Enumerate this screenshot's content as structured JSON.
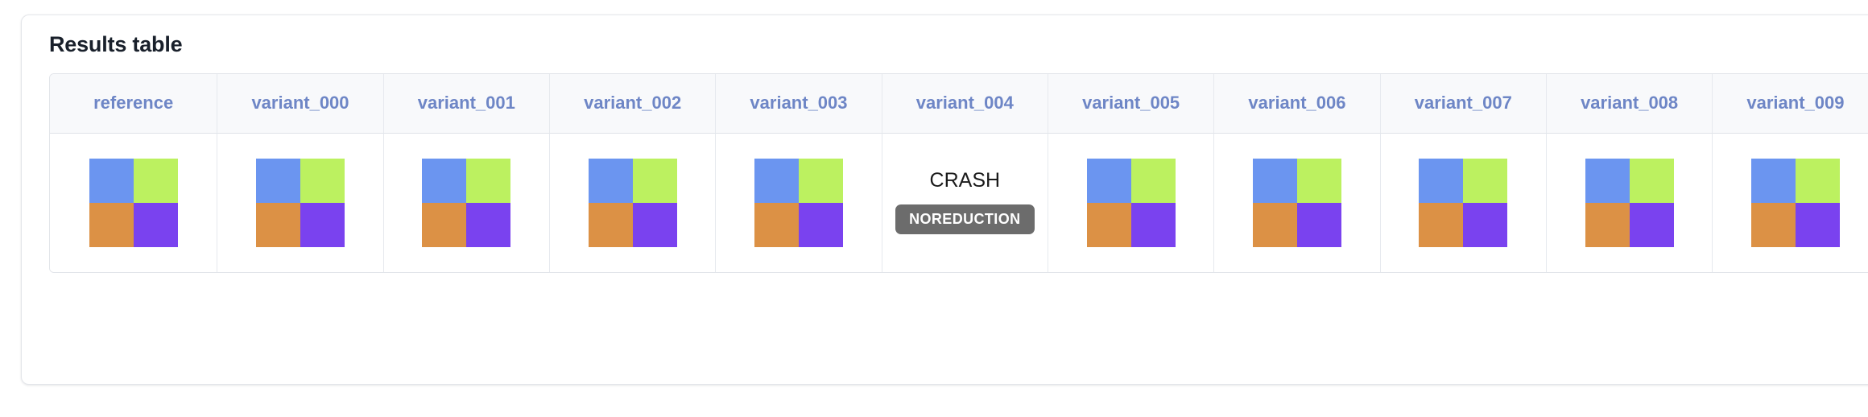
{
  "card": {
    "title": "Results table"
  },
  "table": {
    "columns": [
      {
        "label": "reference"
      },
      {
        "label": "variant_000"
      },
      {
        "label": "variant_001"
      },
      {
        "label": "variant_002"
      },
      {
        "label": "variant_003"
      },
      {
        "label": "variant_004"
      },
      {
        "label": "variant_005"
      },
      {
        "label": "variant_006"
      },
      {
        "label": "variant_007"
      },
      {
        "label": "variant_008"
      },
      {
        "label": "variant_009"
      },
      {
        "label": ""
      }
    ],
    "cells": [
      {
        "type": "swatch",
        "column": "reference"
      },
      {
        "type": "swatch",
        "column": "variant_000"
      },
      {
        "type": "swatch",
        "column": "variant_001"
      },
      {
        "type": "swatch",
        "column": "variant_002"
      },
      {
        "type": "swatch",
        "column": "variant_003"
      },
      {
        "type": "crash",
        "column": "variant_004",
        "status": "CRASH",
        "badge": "NOREDUCTION"
      },
      {
        "type": "swatch",
        "column": "variant_005"
      },
      {
        "type": "swatch",
        "column": "variant_006"
      },
      {
        "type": "swatch",
        "column": "variant_007"
      },
      {
        "type": "swatch",
        "column": "variant_008"
      },
      {
        "type": "swatch",
        "column": "variant_009"
      },
      {
        "type": "swatch",
        "column": ""
      }
    ],
    "swatch_quadrants": {
      "top_left": "#6b95f0",
      "top_right": "#bcf160",
      "bottom_left": "#dc9145",
      "bottom_right": "#7a42ef"
    }
  },
  "colors": {
    "card_background": "#ffffff",
    "card_border": "#e4e6ea",
    "header_background": "#f8f9fb",
    "header_text": "#6e86c6",
    "title_text": "#19202b",
    "grid_line": "#e6e9ee",
    "crash_cell_background": "#e3b0ab",
    "crash_text": "#1b1b1b",
    "badge_background": "#6c6c6c",
    "badge_text": "#ffffff"
  }
}
